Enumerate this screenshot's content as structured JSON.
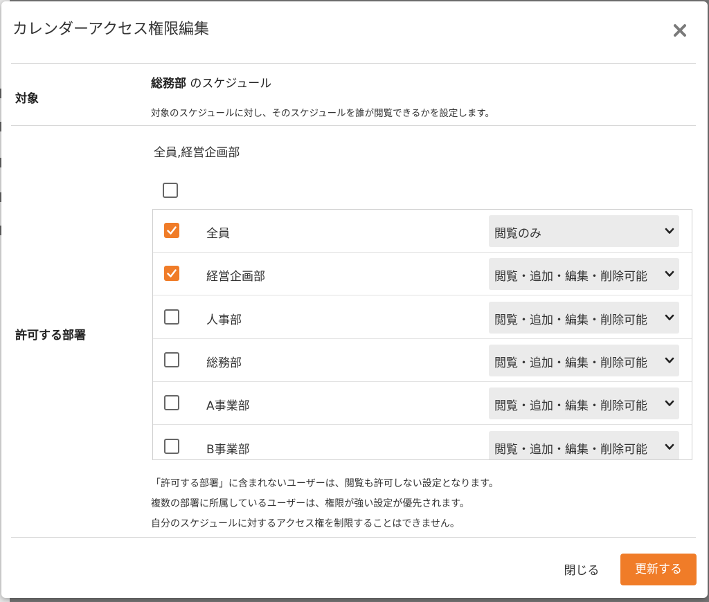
{
  "dialog": {
    "title": "カレンダーアクセス権限編集",
    "close_icon": "close-icon"
  },
  "target": {
    "label": "対象",
    "name": "総務部",
    "name_suffix": "のスケジュール",
    "description": "対象のスケジュールに対し、そのスケジュールを誰が閲覧できるかを設定します。"
  },
  "permissions": {
    "label": "許可する部署",
    "summary": "全員,経営企画部",
    "select_all_checked": false,
    "rows": [
      {
        "dept": "全員",
        "checked": true,
        "permission": "閲覧のみ"
      },
      {
        "dept": "経営企画部",
        "checked": true,
        "permission": "閲覧・追加・編集・削除可能"
      },
      {
        "dept": "人事部",
        "checked": false,
        "permission": "閲覧・追加・編集・削除可能"
      },
      {
        "dept": "総務部",
        "checked": false,
        "permission": "閲覧・追加・編集・削除可能"
      },
      {
        "dept": "A事業部",
        "checked": false,
        "permission": "閲覧・追加・編集・削除可能"
      },
      {
        "dept": "B事業部",
        "checked": false,
        "permission": "閲覧・追加・編集・削除可能"
      }
    ],
    "notes": [
      "「許可する部署」に含まれないユーザーは、閲覧も許可しない設定となります。",
      "複数の部署に所属しているユーザーは、権限が強い設定が優先されます。",
      "自分のスケジュールに対するアクセス権を制限することはできません。"
    ]
  },
  "footer": {
    "close_label": "閉じる",
    "update_label": "更新する"
  },
  "colors": {
    "accent": "#f07c28"
  }
}
